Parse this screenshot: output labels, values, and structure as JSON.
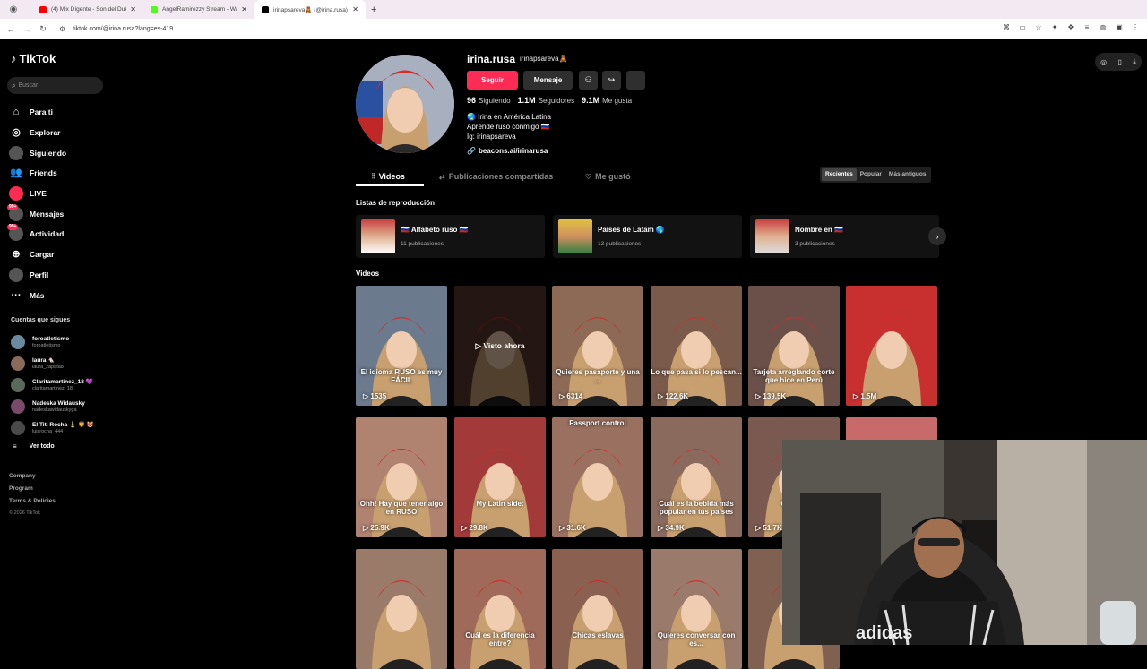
{
  "browser": {
    "tabs": [
      {
        "title": "(4) Mix Dígente - Son del Duk",
        "color": "#ff0000"
      },
      {
        "title": "AngelRamirezzy Stream - Watch",
        "color": "#53fc18"
      },
      {
        "title": "irinapsareva🧸 (@irina.rusa) | TikT",
        "color": "#000000"
      }
    ],
    "url": "tiktok.com/@irina.rusa?lang=es-419"
  },
  "sidebar": {
    "logo": "TikTok",
    "search_placeholder": "Buscar",
    "nav": [
      {
        "label": "Para ti",
        "icon": "home-icon"
      },
      {
        "label": "Explorar",
        "icon": "compass-icon"
      },
      {
        "label": "Siguiendo",
        "icon": "following-icon"
      },
      {
        "label": "Friends",
        "icon": "friends-icon"
      },
      {
        "label": "LIVE",
        "icon": "live-icon"
      },
      {
        "label": "Mensajes",
        "icon": "messages-icon",
        "badge": "99+"
      },
      {
        "label": "Actividad",
        "icon": "activity-icon",
        "badge": "99+"
      },
      {
        "label": "Cargar",
        "icon": "upload-icon"
      },
      {
        "label": "Perfil",
        "icon": "profile-icon"
      },
      {
        "label": "Más",
        "icon": "more-icon"
      }
    ],
    "following_title": "Cuentas que sigues",
    "following": [
      {
        "name": "foroatletismo",
        "handle": "foroatletismo"
      },
      {
        "name": "laura 🐁",
        "handle": "laura_zapata8"
      },
      {
        "name": "Claritamartinez_18 💜",
        "handle": "claritamartinez_18"
      },
      {
        "name": "Nadeska Widausky",
        "handle": "nadeskawidauskyga"
      },
      {
        "name": "El Titi Rocha 🎍 🦁 😻",
        "handle": "luisrocha_444"
      }
    ],
    "see_all": "Ver todo",
    "footer": [
      "Company",
      "Program",
      "Terms & Policies"
    ],
    "copyright": "© 2026 TikTok"
  },
  "profile": {
    "username": "irina.rusa",
    "nickname": "irinapsareva🧸",
    "follow_label": "Seguir",
    "message_label": "Mensaje",
    "stats": [
      {
        "value": "96",
        "label": "Siguiendo"
      },
      {
        "value": "1.1M",
        "label": "Seguidores"
      },
      {
        "value": "9.1M",
        "label": "Me gusta"
      }
    ],
    "bio": [
      "🌏 Irina en América Latina",
      "Aprende ruso conmigo 🇷🇺",
      "Ig: irinapsareva"
    ],
    "link": "beacons.ai/irinarusa"
  },
  "tabs": [
    {
      "label": "Videos"
    },
    {
      "label": "Publicaciones compartidas"
    },
    {
      "label": "Me gustó"
    }
  ],
  "sort": [
    "Recientes",
    "Popular",
    "Más antiguos"
  ],
  "playlists_title": "Listas de reproducción",
  "playlists": [
    {
      "name": "🇷🇺 Alfabeto ruso 🇷🇺",
      "count": "11 publicaciones"
    },
    {
      "name": "Países de Latam 🌎",
      "count": "13 publicaciones"
    },
    {
      "name": "Nombre en 🇷🇺",
      "count": "3 publicaciones"
    }
  ],
  "videos_title": "Videos",
  "videos": [
    {
      "views": "▷ 1535",
      "caption": "El idioma RUSO es muy FÁCIL",
      "bg": "#6b7a8c"
    },
    {
      "views": "",
      "caption": "",
      "watched": "▷ Visto ahora",
      "bg": "#5a3a30"
    },
    {
      "views": "▷ 6314",
      "caption": "Quieres pasaporte y una ...",
      "bg": "#8c6a55"
    },
    {
      "views": "▷ 122.6K",
      "caption": "Lo que pasa si lo pescan...",
      "bg": "#7a5a4a"
    },
    {
      "views": "▷ 139.5K",
      "caption": "Tarjeta arreglando corte que hice en Perú",
      "bg": "#6a5048"
    },
    {
      "views": "▷ 1.5M",
      "caption": "",
      "bg": "#c83030"
    },
    {
      "views": "▷ 25.9K",
      "caption": "Ohh! Hay que tener algo en RUSO",
      "bg": "#b08270"
    },
    {
      "views": "▷ 29.8K",
      "caption": "My Latin side:",
      "bg": "#a23a3a"
    },
    {
      "views": "▷ 31.6K",
      "caption": "Passport control",
      "bg": "#9a7060"
    },
    {
      "views": "▷ 34.9K",
      "caption": "Cuál es la bebida más popular en tus países",
      "bg": "#8a6a5c"
    },
    {
      "views": "▷ 51.7K",
      "caption": "Como...",
      "bg": "#7a5a50"
    },
    {
      "views": "",
      "caption": "",
      "bg": "#c86a6a"
    },
    {
      "views": "",
      "caption": "",
      "bg": "#9a7a68"
    },
    {
      "views": "",
      "caption": "Cuál es la diferencia entre?",
      "bg": "#a06a5a"
    },
    {
      "views": "",
      "caption": "Chicas eslavas",
      "bg": "#8a6050"
    },
    {
      "views": "",
      "caption": "Quieres conversar con es...",
      "bg": "#9a7a6a"
    },
    {
      "views": "",
      "caption": "",
      "bg": "#806050"
    }
  ],
  "webcam": {
    "shirt_brand": "adidas"
  },
  "colors": {
    "accent": "#fe2c55",
    "background": "#000000"
  }
}
